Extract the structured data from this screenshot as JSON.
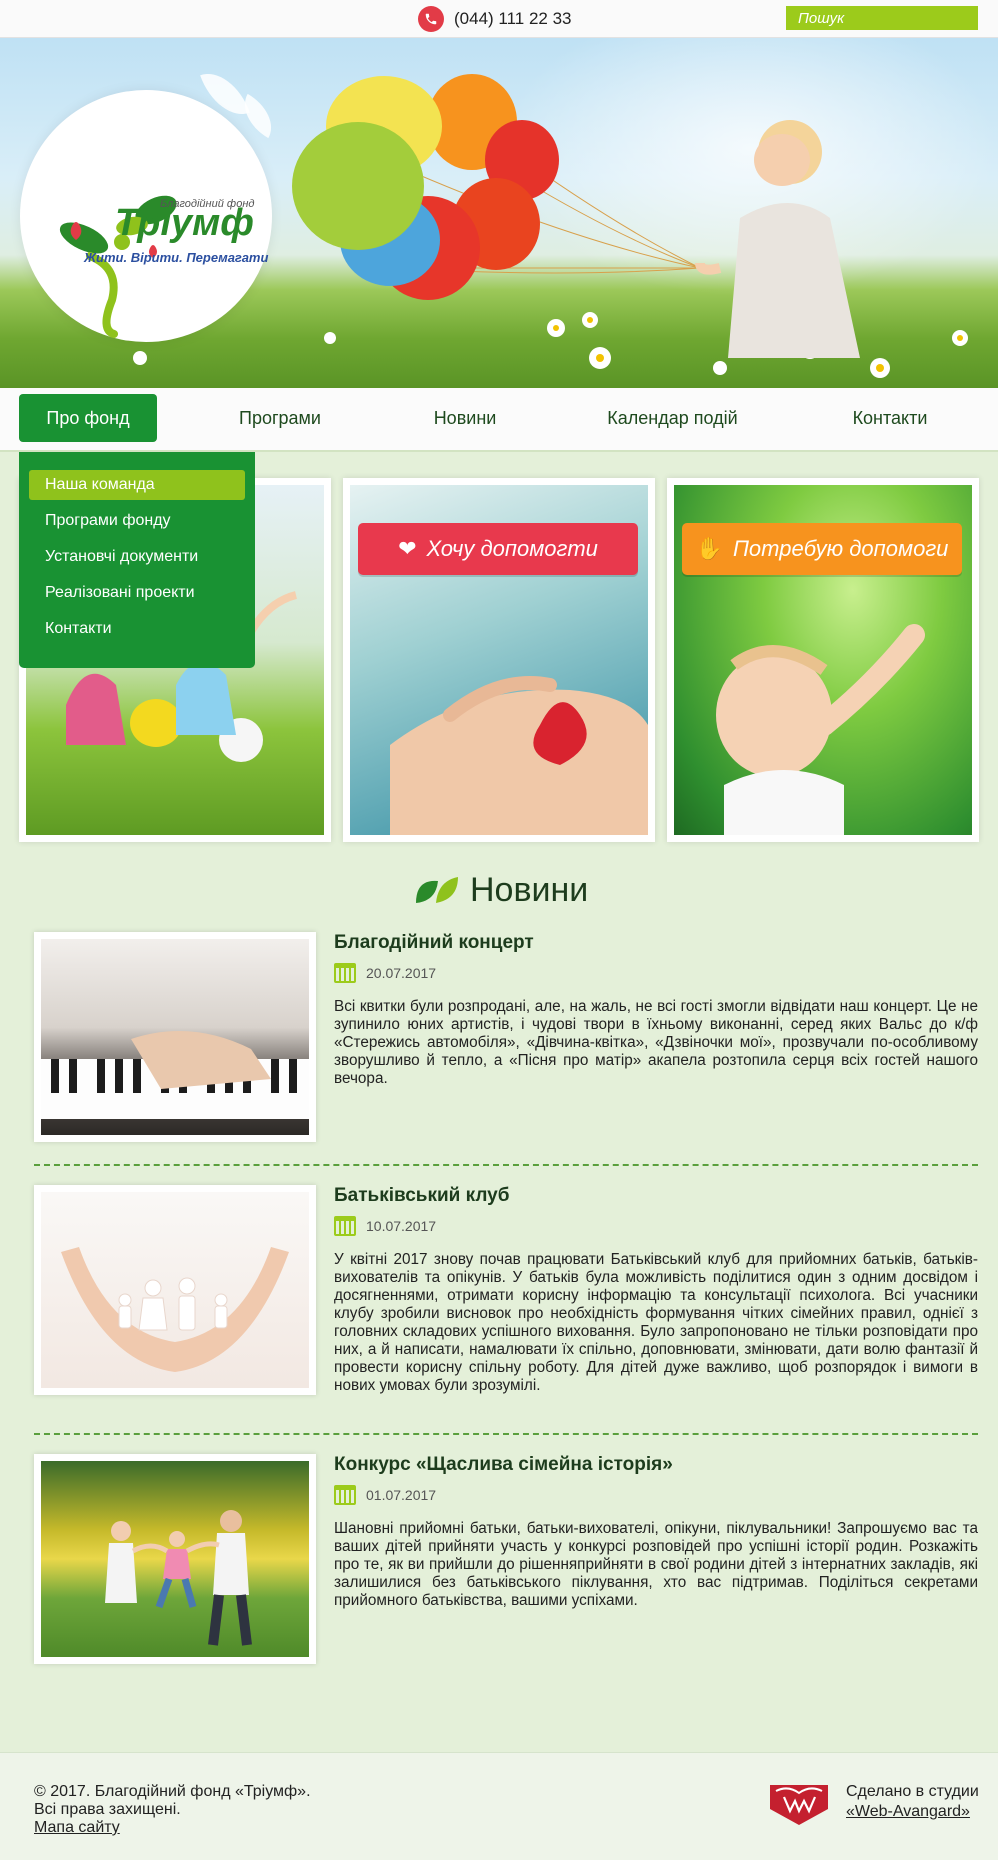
{
  "topbar": {
    "phone": "(044) 111 22 33",
    "phone_icon": "phone-icon",
    "search_placeholder": "Пошук",
    "search_icon": "magnifier-icon"
  },
  "logo": {
    "subtitle": "Благодійний фонд",
    "name": "Тріумф",
    "tagline": "Жити. Вірити. Перемагати"
  },
  "nav": {
    "items": [
      "Про фонд",
      "Програми",
      "Новини",
      "Календар подій",
      "Контакти"
    ],
    "active": "Про фонд"
  },
  "dropdown": {
    "items": [
      "Наша команда",
      "Програми фонду",
      "Установчі документи",
      "Реалізовані проекти",
      "Контакти"
    ],
    "active": "Наша команда"
  },
  "cards": [
    {
      "button": "Хочу допомогти",
      "color": "#e8394d",
      "icon": "heart-icon"
    },
    {
      "button": "Потребую допомоги",
      "color": "#f7931e",
      "icon": "hand-icon"
    }
  ],
  "news": {
    "title": "Новини",
    "items": [
      {
        "title": "Благодійний концерт",
        "date": "20.07.2017",
        "text": "Всі квитки були розпродані, але, на жаль, не всі гості змогли відвідати наш концерт. Це не зупинило юних артистів, і чудові твори в їхньому виконанні, серед яких Вальс до к/ф «Стережись автомобіля», «Дівчина-квітка», «Дзвіночки мої», прозвучали по-особливому зворушливо й тепло, а «Пісня про матір» акапела розтопила серця всіх гостей нашого вечора."
      },
      {
        "title": "Батьківський клуб",
        "date": "10.07.2017",
        "text": "У квітні 2017 знову почав працювати Батьківський клуб для прийомних батьків, батьків-вихователів та опікунів. У батьків була можливість поділитися один з одним досвідом і досягненнями, отримати корисну інформацію та консультації психолога. Всі учасники клубу зробили висновок про необхідність формування чітких сімейних правил, однієї з головних складових успішного виховання. Було запропоновано не тільки розповідати про них, а й написати, намалювати їх спільно, доповнювати, змінювати, дати волю фантазії й провести корисну спільну роботу. Для дітей дуже важливо, щоб розпорядок і вимоги в нових умовах були зрозумілі."
      },
      {
        "title": "Конкурс «Щаслива сімейна історія»",
        "date": "01.07.2017",
        "text": "Шановні прийомні батьки, батьки-вихователі, опікуни, піклувальники! Запрошуємо вас та ваших дітей прийняти участь у конкурсі розповідей про успішні історії родин. Розкажіть про те, як ви прийшли до рішенняприйняти в свої родини дітей з інтернатних закладів, які залишилися без батьківського піклування, хто вас підтримав. Поділіться секретами прийомного батьківства, вашими успіхами."
      }
    ]
  },
  "footer": {
    "copyright_line1": "© 2017. Благодійний фонд «Тріумф».",
    "copyright_line2": "Всі права захищені.",
    "sitemap": "Мапа сайту",
    "studio_made": "Сделано в студии",
    "studio_name": "«Web-Avangard»"
  }
}
